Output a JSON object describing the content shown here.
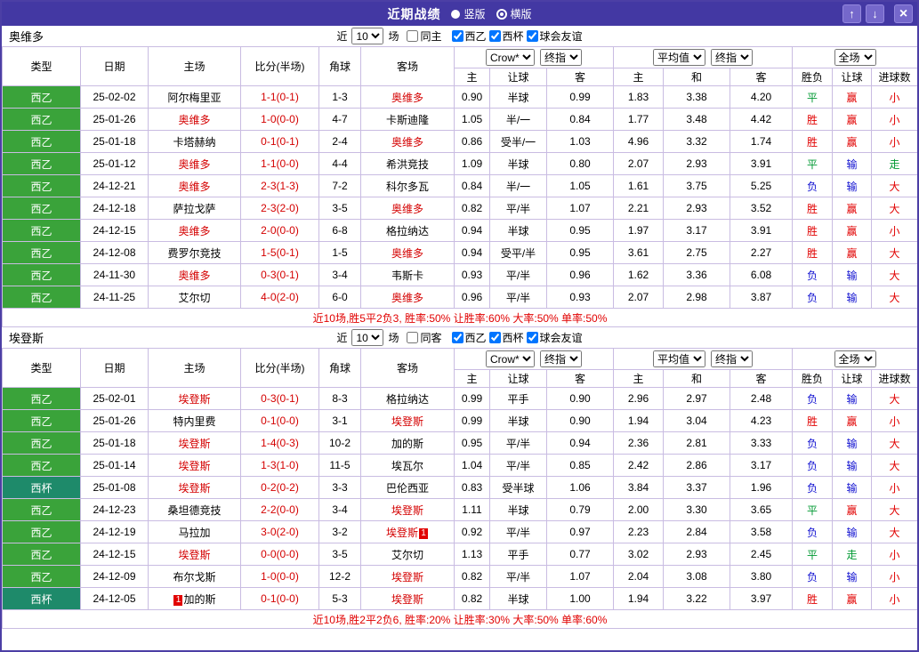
{
  "titlebar": {
    "title": "近期战绩",
    "vertical_label": "竖版",
    "horizontal_label": "横版",
    "up_icon": "↑",
    "down_icon": "↓",
    "close_icon": "×"
  },
  "colors": {
    "header_bg": "#4338a3",
    "button_bg": "#7568cb",
    "grid_border": "#c9bce2",
    "league_badge": "#3aa33a",
    "cup_badge": "#1e8a6a",
    "red": "#e10000",
    "blue": "#1010d0",
    "green": "#009933",
    "focal_team": "#d40000",
    "score": "#d40000"
  },
  "table_columns": [
    "类型",
    "日期",
    "主场",
    "比分(半场)",
    "角球",
    "客场",
    "主",
    "让球",
    "客",
    "主",
    "和",
    "客",
    "胜负",
    "让球",
    "进球数"
  ],
  "sections": [
    {
      "team": "奥维多",
      "filter": {
        "pre": "近",
        "count": "10",
        "post": "场",
        "venue": "同主",
        "venue_checked": false,
        "leagues": [
          {
            "label": "西乙",
            "checked": true
          },
          {
            "label": "西杯",
            "checked": true
          },
          {
            "label": "球会友谊",
            "checked": true
          }
        ]
      },
      "selects": {
        "company": "Crow*",
        "final1": "终指",
        "average": "平均值",
        "final2": "终指",
        "scope": "全场"
      },
      "rows": [
        {
          "type": "西乙",
          "type_style": "league",
          "date": "25-02-02",
          "home": "阿尔梅里亚",
          "home_focal": false,
          "score": "1-1(0-1)",
          "corners": "1-3",
          "away": "奥维多",
          "away_focal": true,
          "odds": [
            "0.90",
            "半球",
            "0.99"
          ],
          "avg": [
            "1.83",
            "3.38",
            "4.20"
          ],
          "results": [
            {
              "t": "平",
              "c": "green"
            },
            {
              "t": "赢",
              "c": "red"
            },
            {
              "t": "小",
              "c": "red"
            }
          ]
        },
        {
          "type": "西乙",
          "type_style": "league",
          "date": "25-01-26",
          "home": "奥维多",
          "home_focal": true,
          "score": "1-0(0-0)",
          "corners": "4-7",
          "away": "卡斯迪隆",
          "away_focal": false,
          "odds": [
            "1.05",
            "半/一",
            "0.84"
          ],
          "avg": [
            "1.77",
            "3.48",
            "4.42"
          ],
          "results": [
            {
              "t": "胜",
              "c": "red"
            },
            {
              "t": "赢",
              "c": "red"
            },
            {
              "t": "小",
              "c": "red"
            }
          ]
        },
        {
          "type": "西乙",
          "type_style": "league",
          "date": "25-01-18",
          "home": "卡塔赫纳",
          "home_focal": false,
          "score": "0-1(0-1)",
          "corners": "2-4",
          "away": "奥维多",
          "away_focal": true,
          "odds": [
            "0.86",
            "受半/一",
            "1.03"
          ],
          "avg": [
            "4.96",
            "3.32",
            "1.74"
          ],
          "results": [
            {
              "t": "胜",
              "c": "red"
            },
            {
              "t": "赢",
              "c": "red"
            },
            {
              "t": "小",
              "c": "red"
            }
          ]
        },
        {
          "type": "西乙",
          "type_style": "league",
          "date": "25-01-12",
          "home": "奥维多",
          "home_focal": true,
          "score": "1-1(0-0)",
          "corners": "4-4",
          "away": "希洪竞技",
          "away_focal": false,
          "odds": [
            "1.09",
            "半球",
            "0.80"
          ],
          "avg": [
            "2.07",
            "2.93",
            "3.91"
          ],
          "results": [
            {
              "t": "平",
              "c": "green"
            },
            {
              "t": "输",
              "c": "blue"
            },
            {
              "t": "走",
              "c": "green"
            }
          ]
        },
        {
          "type": "西乙",
          "type_style": "league",
          "date": "24-12-21",
          "home": "奥维多",
          "home_focal": true,
          "score": "2-3(1-3)",
          "corners": "7-2",
          "away": "科尔多瓦",
          "away_focal": false,
          "odds": [
            "0.84",
            "半/一",
            "1.05"
          ],
          "avg": [
            "1.61",
            "3.75",
            "5.25"
          ],
          "results": [
            {
              "t": "负",
              "c": "blue"
            },
            {
              "t": "输",
              "c": "blue"
            },
            {
              "t": "大",
              "c": "red"
            }
          ]
        },
        {
          "type": "西乙",
          "type_style": "league",
          "date": "24-12-18",
          "home": "萨拉戈萨",
          "home_focal": false,
          "score": "2-3(2-0)",
          "corners": "3-5",
          "away": "奥维多",
          "away_focal": true,
          "odds": [
            "0.82",
            "平/半",
            "1.07"
          ],
          "avg": [
            "2.21",
            "2.93",
            "3.52"
          ],
          "results": [
            {
              "t": "胜",
              "c": "red"
            },
            {
              "t": "赢",
              "c": "red"
            },
            {
              "t": "大",
              "c": "red"
            }
          ]
        },
        {
          "type": "西乙",
          "type_style": "league",
          "date": "24-12-15",
          "home": "奥维多",
          "home_focal": true,
          "score": "2-0(0-0)",
          "corners": "6-8",
          "away": "格拉纳达",
          "away_focal": false,
          "odds": [
            "0.94",
            "半球",
            "0.95"
          ],
          "avg": [
            "1.97",
            "3.17",
            "3.91"
          ],
          "results": [
            {
              "t": "胜",
              "c": "red"
            },
            {
              "t": "赢",
              "c": "red"
            },
            {
              "t": "小",
              "c": "red"
            }
          ]
        },
        {
          "type": "西乙",
          "type_style": "league",
          "date": "24-12-08",
          "home": "费罗尔竞技",
          "home_focal": false,
          "score": "1-5(0-1)",
          "corners": "1-5",
          "away": "奥维多",
          "away_focal": true,
          "odds": [
            "0.94",
            "受平/半",
            "0.95"
          ],
          "avg": [
            "3.61",
            "2.75",
            "2.27"
          ],
          "results": [
            {
              "t": "胜",
              "c": "red"
            },
            {
              "t": "赢",
              "c": "red"
            },
            {
              "t": "大",
              "c": "red"
            }
          ]
        },
        {
          "type": "西乙",
          "type_style": "league",
          "date": "24-11-30",
          "home": "奥维多",
          "home_focal": true,
          "score": "0-3(0-1)",
          "corners": "3-4",
          "away": "韦斯卡",
          "away_focal": false,
          "odds": [
            "0.93",
            "平/半",
            "0.96"
          ],
          "avg": [
            "1.62",
            "3.36",
            "6.08"
          ],
          "results": [
            {
              "t": "负",
              "c": "blue"
            },
            {
              "t": "输",
              "c": "blue"
            },
            {
              "t": "大",
              "c": "red"
            }
          ]
        },
        {
          "type": "西乙",
          "type_style": "league",
          "date": "24-11-25",
          "home": "艾尔切",
          "home_focal": false,
          "score": "4-0(2-0)",
          "corners": "6-0",
          "away": "奥维多",
          "away_focal": true,
          "odds": [
            "0.96",
            "平/半",
            "0.93"
          ],
          "avg": [
            "2.07",
            "2.98",
            "3.87"
          ],
          "results": [
            {
              "t": "负",
              "c": "blue"
            },
            {
              "t": "输",
              "c": "blue"
            },
            {
              "t": "大",
              "c": "red"
            }
          ]
        }
      ],
      "summary": "近10场,胜5平2负3, 胜率:50% 让胜率:60% 大率:50% 单率:50%"
    },
    {
      "team": "埃登斯",
      "filter": {
        "pre": "近",
        "count": "10",
        "post": "场",
        "venue": "同客",
        "venue_checked": false,
        "leagues": [
          {
            "label": "西乙",
            "checked": true
          },
          {
            "label": "西杯",
            "checked": true
          },
          {
            "label": "球会友谊",
            "checked": true
          }
        ]
      },
      "selects": {
        "company": "Crow*",
        "final1": "终指",
        "average": "平均值",
        "final2": "终指",
        "scope": "全场"
      },
      "rows": [
        {
          "type": "西乙",
          "type_style": "league",
          "date": "25-02-01",
          "home": "埃登斯",
          "home_focal": true,
          "score": "0-3(0-1)",
          "corners": "8-3",
          "away": "格拉纳达",
          "away_focal": false,
          "odds": [
            "0.99",
            "平手",
            "0.90"
          ],
          "avg": [
            "2.96",
            "2.97",
            "2.48"
          ],
          "results": [
            {
              "t": "负",
              "c": "blue"
            },
            {
              "t": "输",
              "c": "blue"
            },
            {
              "t": "大",
              "c": "red"
            }
          ]
        },
        {
          "type": "西乙",
          "type_style": "league",
          "date": "25-01-26",
          "home": "特内里费",
          "home_focal": false,
          "score": "0-1(0-0)",
          "corners": "3-1",
          "away": "埃登斯",
          "away_focal": true,
          "odds": [
            "0.99",
            "半球",
            "0.90"
          ],
          "avg": [
            "1.94",
            "3.04",
            "4.23"
          ],
          "results": [
            {
              "t": "胜",
              "c": "red"
            },
            {
              "t": "赢",
              "c": "red"
            },
            {
              "t": "小",
              "c": "red"
            }
          ]
        },
        {
          "type": "西乙",
          "type_style": "league",
          "date": "25-01-18",
          "home": "埃登斯",
          "home_focal": true,
          "score": "1-4(0-3)",
          "corners": "10-2",
          "away": "加的斯",
          "away_focal": false,
          "odds": [
            "0.95",
            "平/半",
            "0.94"
          ],
          "avg": [
            "2.36",
            "2.81",
            "3.33"
          ],
          "results": [
            {
              "t": "负",
              "c": "blue"
            },
            {
              "t": "输",
              "c": "blue"
            },
            {
              "t": "大",
              "c": "red"
            }
          ]
        },
        {
          "type": "西乙",
          "type_style": "league",
          "date": "25-01-14",
          "home": "埃登斯",
          "home_focal": true,
          "score": "1-3(1-0)",
          "corners": "11-5",
          "away": "埃瓦尔",
          "away_focal": false,
          "odds": [
            "1.04",
            "平/半",
            "0.85"
          ],
          "avg": [
            "2.42",
            "2.86",
            "3.17"
          ],
          "results": [
            {
              "t": "负",
              "c": "blue"
            },
            {
              "t": "输",
              "c": "blue"
            },
            {
              "t": "大",
              "c": "red"
            }
          ]
        },
        {
          "type": "西杯",
          "type_style": "cup",
          "date": "25-01-08",
          "home": "埃登斯",
          "home_focal": true,
          "score": "0-2(0-2)",
          "corners": "3-3",
          "away": "巴伦西亚",
          "away_focal": false,
          "odds": [
            "0.83",
            "受半球",
            "1.06"
          ],
          "avg": [
            "3.84",
            "3.37",
            "1.96"
          ],
          "results": [
            {
              "t": "负",
              "c": "blue"
            },
            {
              "t": "输",
              "c": "blue"
            },
            {
              "t": "小",
              "c": "red"
            }
          ]
        },
        {
          "type": "西乙",
          "type_style": "league",
          "date": "24-12-23",
          "home": "桑坦德竞技",
          "home_focal": false,
          "score": "2-2(0-0)",
          "corners": "3-4",
          "away": "埃登斯",
          "away_focal": true,
          "odds": [
            "1.11",
            "半球",
            "0.79"
          ],
          "avg": [
            "2.00",
            "3.30",
            "3.65"
          ],
          "results": [
            {
              "t": "平",
              "c": "green"
            },
            {
              "t": "赢",
              "c": "red"
            },
            {
              "t": "大",
              "c": "red"
            }
          ]
        },
        {
          "type": "西乙",
          "type_style": "league",
          "date": "24-12-19",
          "home": "马拉加",
          "home_focal": false,
          "score": "3-0(2-0)",
          "corners": "3-2",
          "away": "埃登斯",
          "away_focal": true,
          "away_card": "1",
          "away_card_pos": "post",
          "odds": [
            "0.92",
            "平/半",
            "0.97"
          ],
          "avg": [
            "2.23",
            "2.84",
            "3.58"
          ],
          "results": [
            {
              "t": "负",
              "c": "blue"
            },
            {
              "t": "输",
              "c": "blue"
            },
            {
              "t": "大",
              "c": "red"
            }
          ]
        },
        {
          "type": "西乙",
          "type_style": "league",
          "date": "24-12-15",
          "home": "埃登斯",
          "home_focal": true,
          "score": "0-0(0-0)",
          "corners": "3-5",
          "away": "艾尔切",
          "away_focal": false,
          "odds": [
            "1.13",
            "平手",
            "0.77"
          ],
          "avg": [
            "3.02",
            "2.93",
            "2.45"
          ],
          "results": [
            {
              "t": "平",
              "c": "green"
            },
            {
              "t": "走",
              "c": "green"
            },
            {
              "t": "小",
              "c": "red"
            }
          ]
        },
        {
          "type": "西乙",
          "type_style": "league",
          "date": "24-12-09",
          "home": "布尔戈斯",
          "home_focal": false,
          "score": "1-0(0-0)",
          "corners": "12-2",
          "away": "埃登斯",
          "away_focal": true,
          "odds": [
            "0.82",
            "平/半",
            "1.07"
          ],
          "avg": [
            "2.04",
            "3.08",
            "3.80"
          ],
          "results": [
            {
              "t": "负",
              "c": "blue"
            },
            {
              "t": "输",
              "c": "blue"
            },
            {
              "t": "小",
              "c": "red"
            }
          ]
        },
        {
          "type": "西杯",
          "type_style": "cup",
          "date": "24-12-05",
          "home": "加的斯",
          "home_focal": false,
          "home_card": "1",
          "home_card_pos": "pre",
          "score": "0-1(0-0)",
          "corners": "5-3",
          "away": "埃登斯",
          "away_focal": true,
          "odds": [
            "0.82",
            "半球",
            "1.00"
          ],
          "avg": [
            "1.94",
            "3.22",
            "3.97"
          ],
          "results": [
            {
              "t": "胜",
              "c": "red"
            },
            {
              "t": "赢",
              "c": "red"
            },
            {
              "t": "小",
              "c": "red"
            }
          ]
        }
      ],
      "summary": "近10场,胜2平2负6, 胜率:20% 让胜率:30% 大率:50% 单率:60%"
    }
  ]
}
